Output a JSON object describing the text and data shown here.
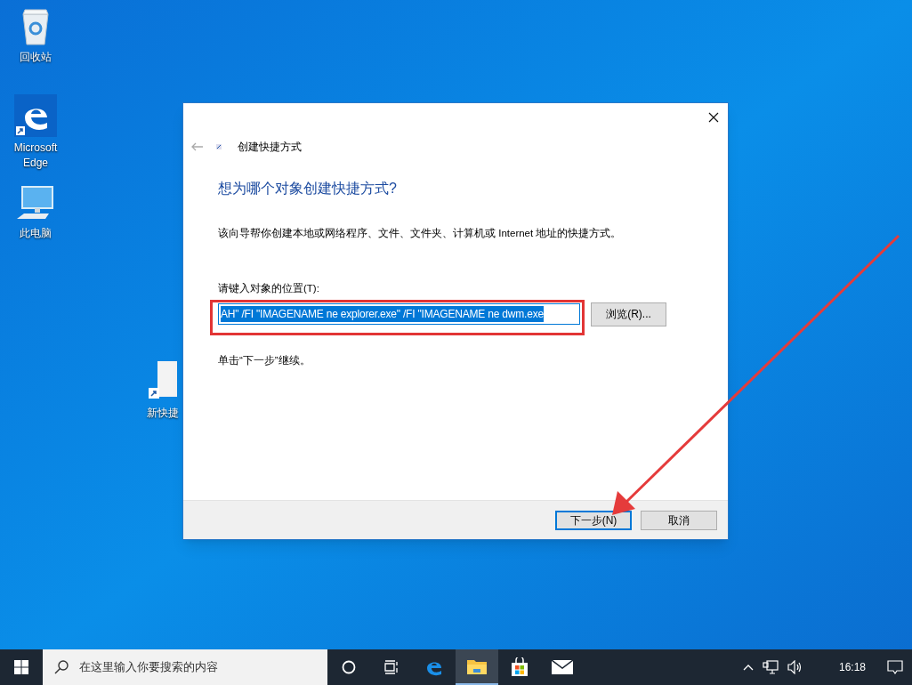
{
  "desktop_icons": [
    {
      "kind": "recycle",
      "label": "回收站"
    },
    {
      "kind": "edge",
      "label": "Microsoft Edge"
    },
    {
      "kind": "pc",
      "label": "此电脑"
    },
    {
      "kind": "file",
      "label": "新快捷"
    }
  ],
  "dialog": {
    "title": "创建快捷方式",
    "heading": "想为哪个对象创建快捷方式?",
    "description": "该向导帮你创建本地或网络程序、文件、文件夹、计算机或 Internet 地址的快捷方式。",
    "field_label": "请键入对象的位置(T):",
    "field_value": "AH\" /FI \"IMAGENAME ne explorer.exe\" /FI \"IMAGENAME ne dwm.exe",
    "text_selected": true,
    "browse_button": "浏览(R)...",
    "hint": "单击“下一步”继续。",
    "buttons": [
      {
        "label": "下一步(N)",
        "default": true
      },
      {
        "label": "取消",
        "default": false
      }
    ]
  },
  "annotations": {
    "highlight_box": true,
    "arrow": true
  },
  "taskbar": {
    "search_placeholder": "在这里输入你要搜索的内容",
    "apps": [
      {
        "kind": "cortana",
        "active": false
      },
      {
        "kind": "taskview",
        "active": false
      },
      {
        "kind": "edge",
        "active": false
      },
      {
        "kind": "explorer",
        "active": true
      },
      {
        "kind": "store",
        "active": false
      },
      {
        "kind": "mail",
        "active": false
      }
    ],
    "time": "16:18"
  }
}
